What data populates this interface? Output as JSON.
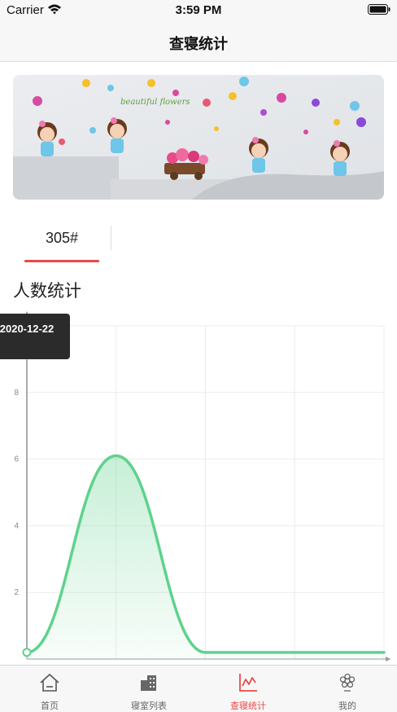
{
  "status_bar": {
    "carrier": "Carrier",
    "time": "3:59 PM"
  },
  "nav": {
    "title": "查寝统计"
  },
  "banner": {
    "icon": "decorative-banner-image"
  },
  "room_tabs": [
    {
      "label": "305#",
      "selected": true
    }
  ],
  "section": {
    "title": "人数统计"
  },
  "tooltip": {
    "label": "2020-12-22"
  },
  "colors": {
    "accent": "#e84a4a",
    "series_line": "#5fd28c",
    "series_fill": "#e2f7ea",
    "tooltip_bg": "#2b2b2b"
  },
  "chart_data": {
    "type": "area",
    "x": [
      0,
      1,
      2,
      3,
      4
    ],
    "values": [
      0.2,
      6.1,
      0.2,
      0.2,
      0.2
    ],
    "xlim": [
      0,
      4
    ],
    "ylim": [
      0,
      10
    ],
    "yticks": [
      2,
      4,
      6,
      8,
      10
    ],
    "smooth": true,
    "grid": true,
    "highlight_index": 0
  },
  "tab_bar": {
    "items": [
      {
        "label": "首页",
        "icon": "home-icon",
        "active": false
      },
      {
        "label": "寝室列表",
        "icon": "building-icon",
        "active": false
      },
      {
        "label": "查寝统计",
        "icon": "stats-chart-icon",
        "active": true
      },
      {
        "label": "我的",
        "icon": "profile-flower-icon",
        "active": false
      }
    ]
  }
}
